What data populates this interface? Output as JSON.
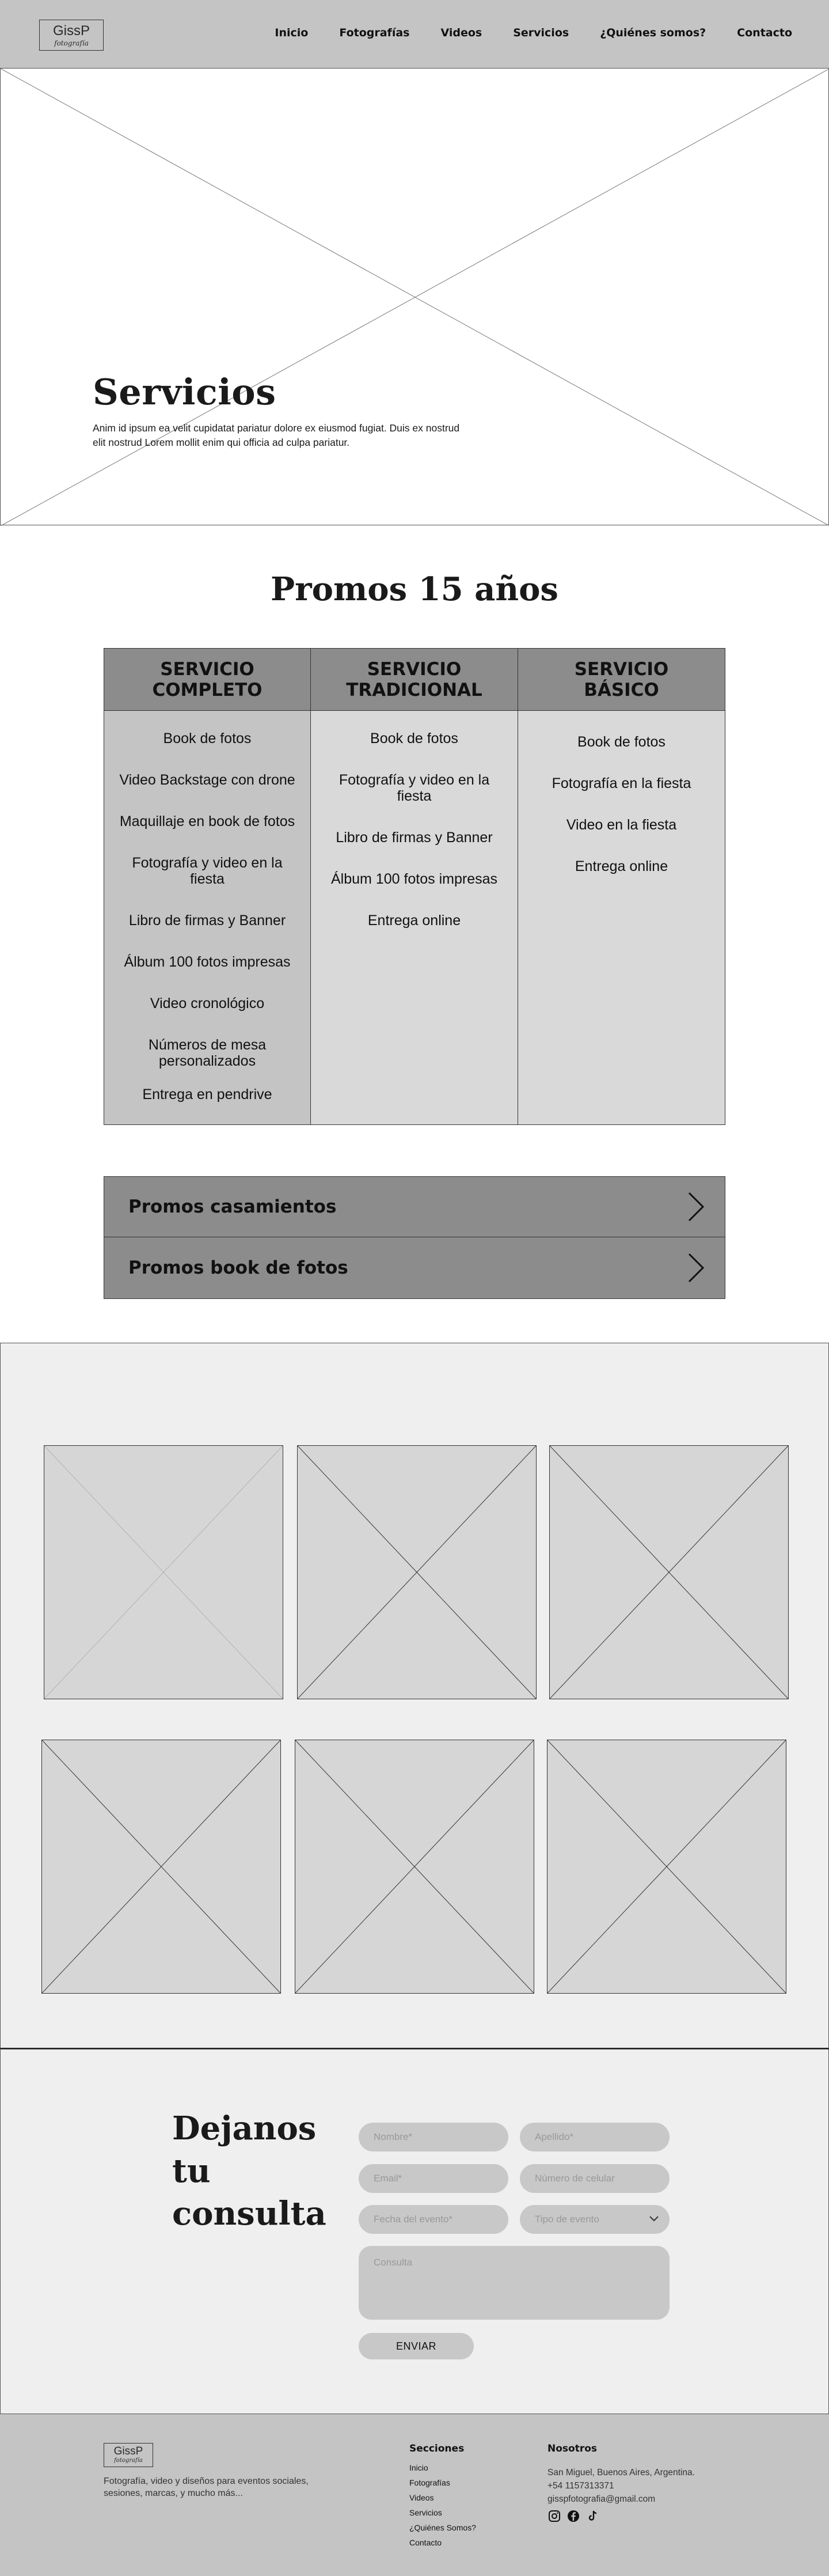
{
  "nav": {
    "logo_name": "GissP",
    "logo_sub": "fotografía",
    "links": [
      "Inicio",
      "Fotografías",
      "Videos",
      "Servicios",
      "¿Quiénes somos?",
      "Contacto"
    ]
  },
  "hero": {
    "title": "Servicios",
    "text": "Anim id ipsum ea velit cupidatat pariatur dolore ex eiusmod fugiat. Duis ex nostrud elit nostrud Lorem mollit enim qui officia ad culpa pariatur."
  },
  "promos15": {
    "title": "Promos 15 años",
    "services": [
      {
        "name": "SERVICIO COMPLETO",
        "items": [
          "Book de fotos",
          "Video Backstage con drone",
          "Maquillaje en book de fotos",
          "Fotografía y video en la fiesta",
          "Libro de firmas y Banner",
          "Álbum 100 fotos impresas",
          "Video cronológico",
          "Números de mesa personalizados",
          "Entrega en pendrive"
        ]
      },
      {
        "name": "SERVICIO TRADICIONAL",
        "items": [
          "Book de fotos",
          "Fotografía y video en la fiesta",
          "Libro de firmas y Banner",
          "Álbum 100 fotos impresas",
          "Entrega online"
        ]
      },
      {
        "name": "SERVICIO BÁSICO",
        "items": [
          "Book de fotos",
          "Fotografía en la fiesta",
          "Video en la fiesta",
          "Entrega online"
        ]
      }
    ]
  },
  "accordions": [
    "Promos casamientos",
    "Promos book de fotos"
  ],
  "contact": {
    "title": "Dejanos tu consulta",
    "fields": {
      "nombre": "Nombre*",
      "apellido": "Apellido*",
      "email": "Email*",
      "celular": "Número de celular",
      "fecha": "Fecha del evento*",
      "tipo": "Tipo de evento",
      "consulta": "Consulta"
    },
    "button": "ENVIAR"
  },
  "footer": {
    "logo_name": "GissP",
    "logo_sub": "fotografía",
    "description": "Fotografía, video y diseños para eventos sociales, sesiones, marcas, y mucho más...",
    "sections_title": "Secciones",
    "sections": [
      "Inicio",
      "Fotografías",
      "Videos",
      "Servicios",
      "¿Quiénes Somos?",
      "Contacto"
    ],
    "about_title": "Nosotros",
    "address": "San Miguel, Buenos Aires, Argentina.",
    "phone": "+54  1157313371",
    "email": "gisspfotografia@gmail.com",
    "social_icons": [
      "instagram-icon",
      "facebook-icon",
      "tiktok-icon"
    ]
  }
}
